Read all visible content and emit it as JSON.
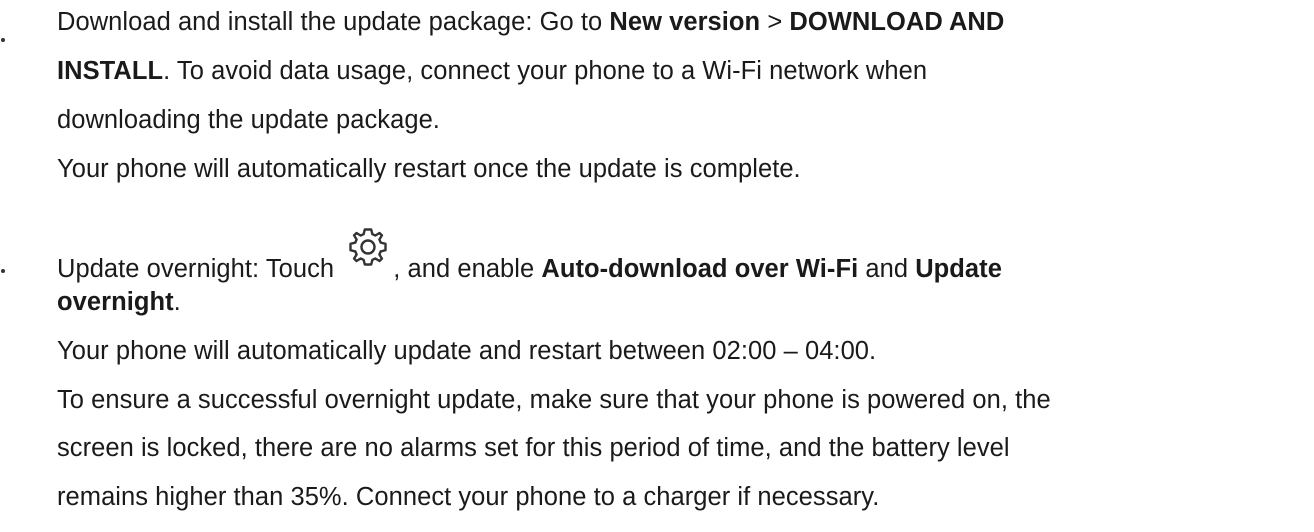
{
  "item1": {
    "intro": "Download and install the update package: Go to ",
    "new_version": "New version",
    "sep": " > ",
    "download_install_1": "DOWNLOAD AND",
    "download_install_2": "INSTALL",
    "rest_1": ". To avoid data usage, connect your phone to a Wi-Fi network when",
    "rest_2": "downloading the update package.",
    "note": "Your phone will automatically restart once the update is complete."
  },
  "item2": {
    "intro": "Update overnight: Touch ",
    "icon": "gear-icon",
    "mid": ", and enable ",
    "auto_download": "Auto-download over Wi-Fi",
    "and": " and ",
    "update_1": "Update",
    "update_2": "overnight",
    "period": ".",
    "note": "Your phone will automatically update and restart between 02:00 – 04:00.",
    "ensure_1": "To ensure a successful overnight update, make sure that your phone is powered on, the",
    "ensure_2": "screen is locked, there are no alarms set for this period of time, and the battery level",
    "ensure_3": "remains higher than 35%. Connect your phone to a charger if necessary."
  }
}
